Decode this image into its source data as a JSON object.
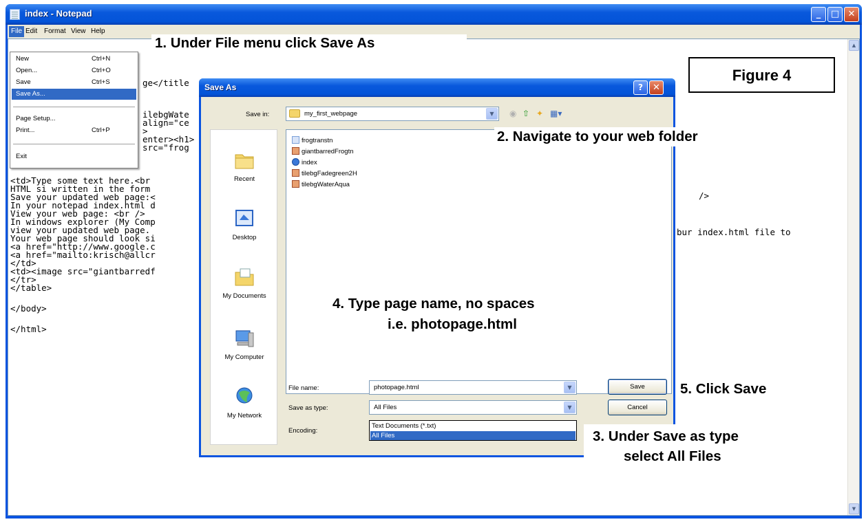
{
  "notepad": {
    "title": "index - Notepad",
    "controls": {
      "minimize": "_",
      "maximize": "□",
      "close": "✕"
    },
    "menu": [
      "File",
      "Edit",
      "Format",
      "View",
      "Help"
    ],
    "code_top": [
      "ge</title",
      "",
      "ilebgWate",
      "align=\"ce",
      ">",
      "enter><h1>",
      "src=\"frog"
    ],
    "code_main": [
      "<td>Type some text here.<br",
      "HTML si written in the form",
      "Save your updated web page:<",
      "In your notepad index.html d",
      "View your web page: <br />",
      "In windows explorer (My Comp",
      "view your updated web page.",
      "Your web page should look si",
      "<a href=\"http://www.google.c",
      "<a href=\"mailto:krisch@allcr",
      "</td>",
      "<td><image src=\"giantbarredf",
      "</tr>",
      "</table>"
    ],
    "code_body": "</body>",
    "code_html": "</html>",
    "code_right_1": "/>",
    "code_right_2": "bur index.html file to"
  },
  "file_menu": {
    "items": [
      {
        "label": "New",
        "shortcut": "Ctrl+N"
      },
      {
        "label": "Open...",
        "shortcut": "Ctrl+O"
      },
      {
        "label": "Save",
        "shortcut": "Ctrl+S"
      },
      {
        "label": "Save As...",
        "shortcut": ""
      },
      {
        "label": "Page Setup...",
        "shortcut": ""
      },
      {
        "label": "Print...",
        "shortcut": "Ctrl+P"
      },
      {
        "label": "Exit",
        "shortcut": ""
      }
    ],
    "highlighted": "Save As..."
  },
  "save_dialog": {
    "title": "Save As",
    "help": "?",
    "close": "✕",
    "save_in_label": "Save in:",
    "save_in_value": "my_first_webpage",
    "places": [
      "Recent",
      "Desktop",
      "My Documents",
      "My Computer",
      "My Network"
    ],
    "files": [
      "frogtranstn",
      "giantbarredFrogtn",
      "index",
      "tilebgFadegreen2H",
      "tilebgWaterAqua"
    ],
    "file_name_label": "File name:",
    "file_name_value": "photopage.html",
    "save_type_label": "Save as type:",
    "save_type_value": "All Files",
    "encoding_label": "Encoding:",
    "type_options": [
      "Text Documents (*.txt)",
      "All Files"
    ],
    "save_button": "Save",
    "cancel_button": "Cancel"
  },
  "annotations": {
    "step1": "1. Under File menu click Save As",
    "figure": "Figure 4",
    "step2": "2. Navigate to your web folder",
    "step4_line1": "4. Type page name, no spaces",
    "step4_line2": "i.e. photopage.html",
    "step5": "5. Click Save",
    "step3_line1": "3. Under Save as type",
    "step3_line2": "select All Files"
  },
  "colors": {
    "xp_blue": "#0a54e0",
    "highlight": "#316ac5",
    "dialog_face": "#ece9d8"
  }
}
